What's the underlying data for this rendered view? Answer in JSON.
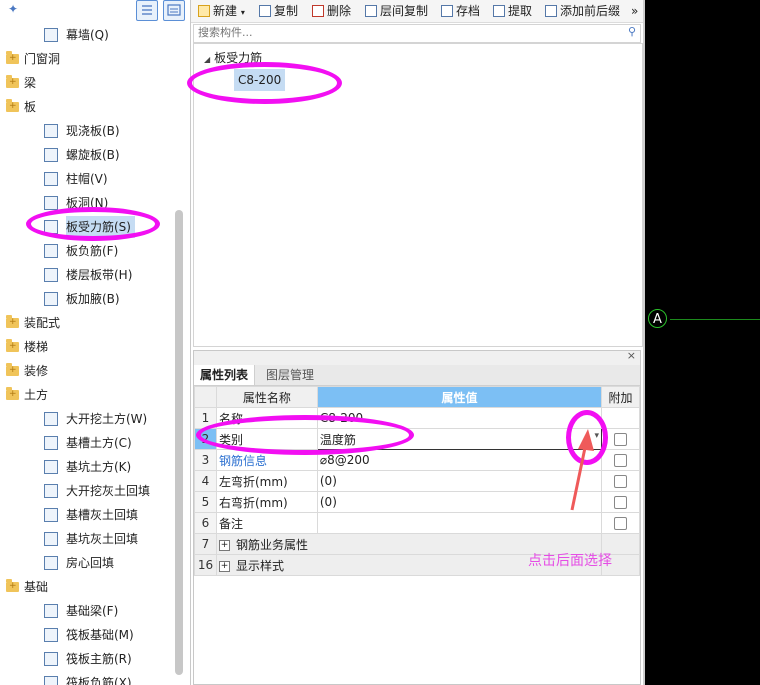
{
  "left_tree": {
    "items": [
      {
        "label": "幕墙(Q)",
        "level": 1,
        "kind": "leaf"
      },
      {
        "label": "门窗洞",
        "level": 0,
        "kind": "folder"
      },
      {
        "label": "梁",
        "level": 0,
        "kind": "folder"
      },
      {
        "label": "板",
        "level": 0,
        "kind": "folder"
      },
      {
        "label": "现浇板(B)",
        "level": 1,
        "kind": "leaf"
      },
      {
        "label": "螺旋板(B)",
        "level": 1,
        "kind": "leaf"
      },
      {
        "label": "柱帽(V)",
        "level": 1,
        "kind": "leaf"
      },
      {
        "label": "板洞(N)",
        "level": 1,
        "kind": "leaf"
      },
      {
        "label": "板受力筋(S)",
        "level": 1,
        "kind": "leaf",
        "selected": true
      },
      {
        "label": "板负筋(F)",
        "level": 1,
        "kind": "leaf"
      },
      {
        "label": "楼层板带(H)",
        "level": 1,
        "kind": "leaf"
      },
      {
        "label": "板加腋(B)",
        "level": 1,
        "kind": "leaf"
      },
      {
        "label": "装配式",
        "level": 0,
        "kind": "folder"
      },
      {
        "label": "楼梯",
        "level": 0,
        "kind": "folder"
      },
      {
        "label": "装修",
        "level": 0,
        "kind": "folder"
      },
      {
        "label": "土方",
        "level": 0,
        "kind": "folder"
      },
      {
        "label": "大开挖土方(W)",
        "level": 1,
        "kind": "leaf"
      },
      {
        "label": "基槽土方(C)",
        "level": 1,
        "kind": "leaf"
      },
      {
        "label": "基坑土方(K)",
        "level": 1,
        "kind": "leaf"
      },
      {
        "label": "大开挖灰土回填",
        "level": 1,
        "kind": "leaf"
      },
      {
        "label": "基槽灰土回填",
        "level": 1,
        "kind": "leaf"
      },
      {
        "label": "基坑灰土回填",
        "level": 1,
        "kind": "leaf"
      },
      {
        "label": "房心回填",
        "level": 1,
        "kind": "leaf"
      },
      {
        "label": "基础",
        "level": 0,
        "kind": "folder"
      },
      {
        "label": "基础梁(F)",
        "level": 1,
        "kind": "leaf"
      },
      {
        "label": "筏板基础(M)",
        "level": 1,
        "kind": "leaf"
      },
      {
        "label": "筏板主筋(R)",
        "level": 1,
        "kind": "leaf"
      },
      {
        "label": "筏板负筋(X)",
        "level": 1,
        "kind": "leaf"
      }
    ]
  },
  "toolbar": {
    "new_label": "新建",
    "copy_label": "复制",
    "delete_label": "删除",
    "floor_copy_label": "层间复制",
    "save_label": "存档",
    "extract_label": "提取",
    "add_label": "添加前后缀",
    "more_symbol": "»"
  },
  "search": {
    "placeholder": "搜索构件..."
  },
  "component_tree": {
    "group_label": "板受力筋",
    "item_label": "C8-200"
  },
  "properties": {
    "tabs": [
      "属性列表",
      "图层管理"
    ],
    "headers": {
      "name": "属性名称",
      "value": "属性值",
      "extra": "附加"
    },
    "rows": [
      {
        "num": "1",
        "name": "名称",
        "value": "C8-200",
        "check": false
      },
      {
        "num": "2",
        "name": "类别",
        "value": "温度筋",
        "check": true
      },
      {
        "num": "3",
        "name": "钢筋信息",
        "value": "⌀8@200",
        "check": true
      },
      {
        "num": "4",
        "name": "左弯折(mm)",
        "value": "(0)",
        "check": true
      },
      {
        "num": "5",
        "name": "右弯折(mm)",
        "value": "(0)",
        "check": true
      },
      {
        "num": "6",
        "name": "备注",
        "value": "",
        "check": true
      },
      {
        "num": "7",
        "name": "钢筋业务属性",
        "value": "",
        "group": true
      },
      {
        "num": "16",
        "name": "显示样式",
        "value": "",
        "group": true
      }
    ]
  },
  "canvas": {
    "axis_label": "A"
  },
  "annotation": {
    "text": "点击后面选择"
  }
}
